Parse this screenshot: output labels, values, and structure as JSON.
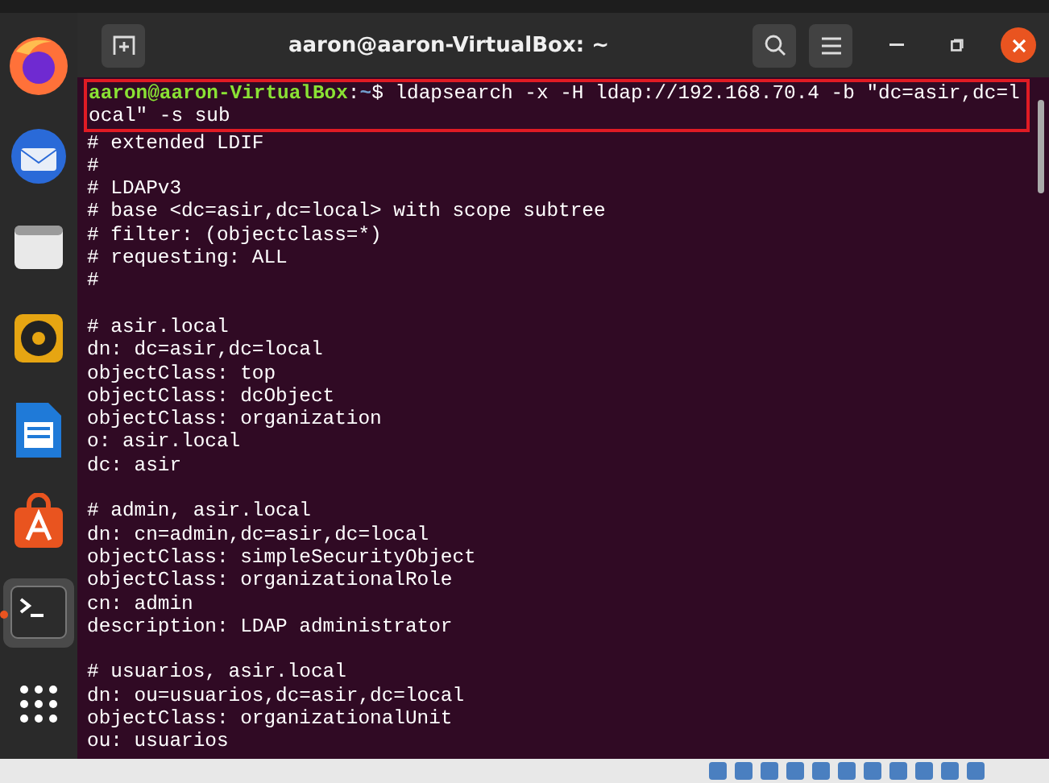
{
  "window": {
    "title": "aaron@aaron-VirtualBox: ~"
  },
  "dock": [
    {
      "kind": "firefox",
      "selected": false
    },
    {
      "kind": "mail",
      "selected": false
    },
    {
      "kind": "files",
      "selected": false
    },
    {
      "kind": "music",
      "selected": false
    },
    {
      "kind": "writer",
      "selected": false
    },
    {
      "kind": "store",
      "selected": false
    },
    {
      "kind": "terminal",
      "selected": true
    },
    {
      "kind": "apps",
      "selected": false
    }
  ],
  "prompt": {
    "user_host": "aaron@aaron-VirtualBox",
    "separator": ":",
    "path": "~",
    "symbol": "$",
    "command": "ldapsearch -x -H ldap://192.168.70.4 -b \"dc=asir,dc=local\" -s sub"
  },
  "output_blocks": [
    [
      "# extended LDIF",
      "#",
      "# LDAPv3",
      "# base <dc=asir,dc=local> with scope subtree",
      "# filter: (objectclass=*)",
      "# requesting: ALL",
      "#"
    ],
    [
      "# asir.local",
      "dn: dc=asir,dc=local",
      "objectClass: top",
      "objectClass: dcObject",
      "objectClass: organization",
      "o: asir.local",
      "dc: asir"
    ],
    [
      "# admin, asir.local",
      "dn: cn=admin,dc=asir,dc=local",
      "objectClass: simpleSecurityObject",
      "objectClass: organizationalRole",
      "cn: admin",
      "description: LDAP administrator"
    ],
    [
      "# usuarios, asir.local",
      "dn: ou=usuarios,dc=asir,dc=local",
      "objectClass: organizationalUnit",
      "ou: usuarios"
    ]
  ]
}
